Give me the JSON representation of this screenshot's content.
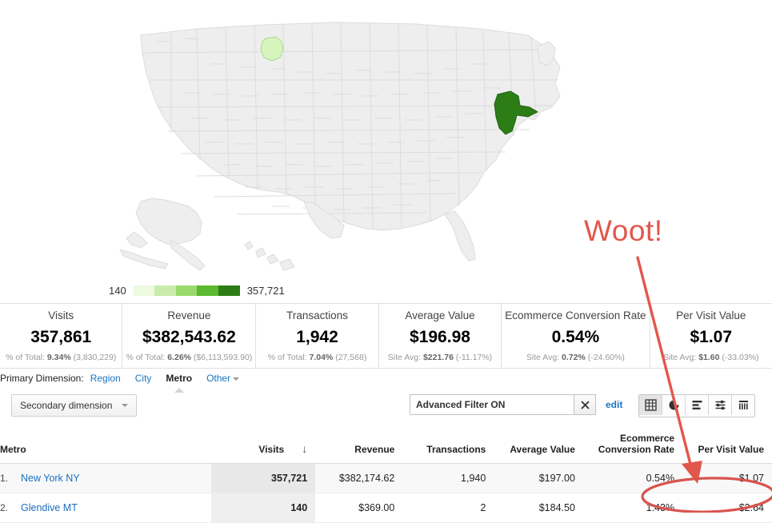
{
  "map": {
    "name": "us-metro-choropleth",
    "legend": {
      "min_label": "140",
      "max_label": "357,721",
      "colors": [
        "#ecfae0",
        "#c9ecab",
        "#9ad96c",
        "#5cb82e",
        "#2d7d17"
      ]
    },
    "highlights": [
      {
        "name": "New York NY",
        "color": "#2d7d17"
      },
      {
        "name": "Glendive MT",
        "color": "#d6f5bd"
      }
    ],
    "base_fill": "#eeeeee",
    "base_stroke": "#dcdcdc"
  },
  "summary": {
    "cards": [
      {
        "label": "Visits",
        "value": "357,861",
        "sub_prefix": "% of Total:",
        "sub_bold": "9.34%",
        "sub_suffix": "(3,830,229)"
      },
      {
        "label": "Revenue",
        "value": "$382,543.62",
        "sub_prefix": "% of Total:",
        "sub_bold": "6.26%",
        "sub_suffix": "($6,113,593.90)"
      },
      {
        "label": "Transactions",
        "value": "1,942",
        "sub_prefix": "% of Total:",
        "sub_bold": "7.04%",
        "sub_suffix": "(27,568)"
      },
      {
        "label": "Average Value",
        "value": "$196.98",
        "sub_prefix": "Site Avg:",
        "sub_bold": "$221.76",
        "sub_suffix": "(-11.17%)"
      },
      {
        "label": "Ecommerce Conversion Rate",
        "value": "0.54%",
        "sub_prefix": "Site Avg:",
        "sub_bold": "0.72%",
        "sub_suffix": "(-24.60%)"
      },
      {
        "label": "Per Visit Value",
        "value": "$1.07",
        "sub_prefix": "Site Avg:",
        "sub_bold": "$1.60",
        "sub_suffix": "(-33.03%)"
      }
    ]
  },
  "primary_dimension": {
    "label": "Primary Dimension:",
    "items": [
      {
        "label": "Region",
        "active": false
      },
      {
        "label": "City",
        "active": false
      },
      {
        "label": "Metro",
        "active": true
      },
      {
        "label": "Other",
        "active": false,
        "has_caret": true
      }
    ]
  },
  "toolbar": {
    "secondary_dimension_label": "Secondary dimension",
    "filter_value": "Advanced Filter ON",
    "filter_placeholder": "Advanced Filter ON",
    "clear_icon": "close-icon",
    "edit_label": "edit",
    "views": [
      {
        "name": "table-view",
        "icon": "grid-icon",
        "active": true
      },
      {
        "name": "pie-view",
        "icon": "pie-chart-icon",
        "active": false
      },
      {
        "name": "bar-view",
        "icon": "horizontal-bars-icon",
        "active": false
      },
      {
        "name": "comparison-view",
        "icon": "pivot-icon",
        "active": false
      },
      {
        "name": "performance-view",
        "icon": "column-bars-icon",
        "active": false
      }
    ]
  },
  "table": {
    "columns": [
      {
        "label": "Metro",
        "align": "left"
      },
      {
        "label": "Visits",
        "align": "right",
        "sorted": true,
        "sort_dir": "↓"
      },
      {
        "label": "Revenue",
        "align": "right"
      },
      {
        "label": "Transactions",
        "align": "right"
      },
      {
        "label": "Average Value",
        "align": "right"
      },
      {
        "label": "Ecommerce\nConversion Rate",
        "align": "right"
      },
      {
        "label": "Per Visit Value",
        "align": "right"
      }
    ],
    "column_labels": {
      "metro": "Metro",
      "visits": "Visits",
      "revenue": "Revenue",
      "transactions": "Transactions",
      "average_value": "Average Value",
      "ecommerce_line1": "Ecommerce",
      "ecommerce_line2": "Conversion Rate",
      "per_visit_value": "Per Visit Value"
    },
    "sort_arrow": "↓",
    "rows": [
      {
        "index": "1.",
        "metro": "New York NY",
        "visits": "357,721",
        "revenue": "$382,174.62",
        "transactions": "1,940",
        "average_value": "$197.00",
        "ecommerce_conversion_rate": "0.54%",
        "per_visit_value": "$1.07"
      },
      {
        "index": "2.",
        "metro": "Glendive MT",
        "visits": "140",
        "revenue": "$369.00",
        "transactions": "2",
        "average_value": "$184.50",
        "ecommerce_conversion_rate": "1.43%",
        "per_visit_value": "$2.64"
      }
    ]
  },
  "annotation": {
    "text": "Woot!",
    "color": "#e2574c",
    "arrow_name": "red-arrow-pointing-to-row-2",
    "ellipse_name": "red-ellipse-highlight"
  }
}
